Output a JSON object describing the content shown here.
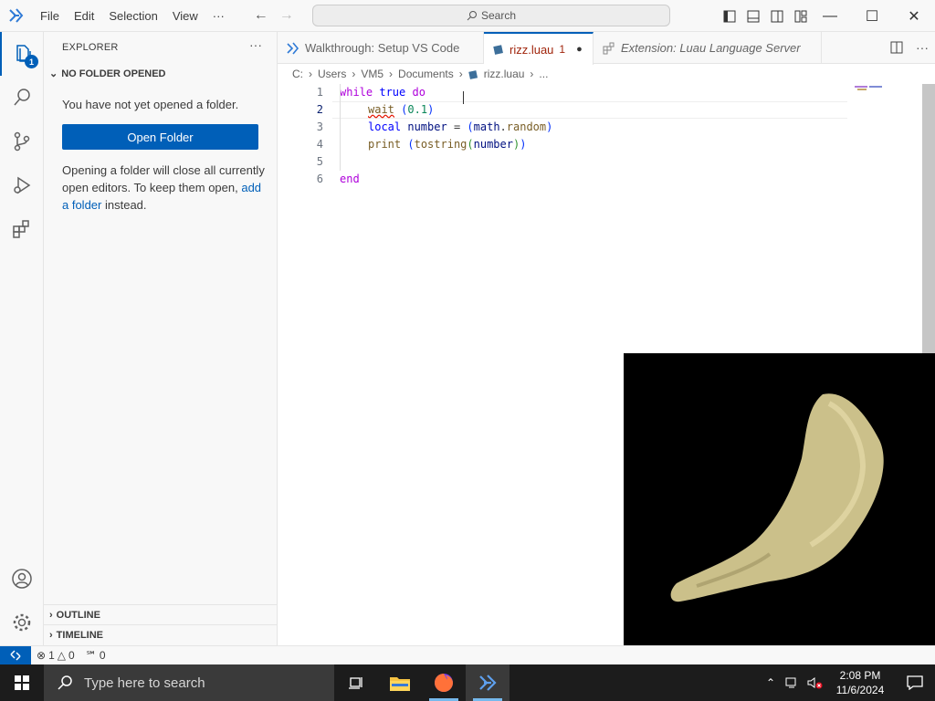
{
  "menu": [
    "File",
    "Edit",
    "Selection",
    "View",
    "···"
  ],
  "search": {
    "label": "Search"
  },
  "explorer": {
    "title": "EXPLORER",
    "more": "···",
    "section": "NO FOLDER OPENED",
    "message": "You have not yet opened a folder.",
    "open_folder": "Open Folder",
    "info_pre": "Opening a folder will close all currently open editors. To keep them open, ",
    "info_link": "add a folder",
    "info_post": " instead.",
    "outline": "OUTLINE",
    "timeline": "TIMELINE"
  },
  "activity": {
    "explorer_badge": "1"
  },
  "tabs": [
    {
      "label": "Walkthrough: Setup VS Code"
    },
    {
      "label": "rizz.luau",
      "problems": "1",
      "dirty": "●"
    },
    {
      "label": "Extension: Luau Language Server"
    }
  ],
  "breadcrumb": [
    "C:",
    "Users",
    "VM5",
    "Documents",
    "rizz.luau",
    "..."
  ],
  "editor": {
    "line_numbers": [
      "1",
      "2",
      "3",
      "4",
      "5",
      "6"
    ],
    "current_line": 2
  },
  "status": {
    "errors": "1",
    "warnings": "0",
    "ports": "0"
  },
  "taskbar": {
    "search_placeholder": "Type here to search",
    "time": "2:08 PM",
    "date": "11/6/2024"
  },
  "colors": {
    "accent": "#005fb8",
    "keyword": "#af00db",
    "function": "#795e26",
    "number": "#098658"
  }
}
